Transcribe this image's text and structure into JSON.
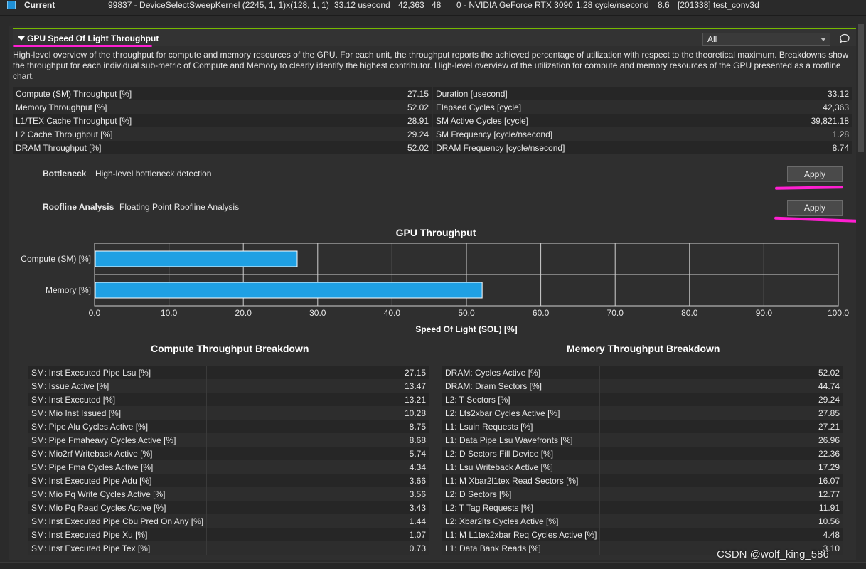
{
  "result": {
    "label": "Current",
    "id_kernel": "99837 - DeviceSelectSweepKernel (2245, 1, 1)x(128, 1, 1)",
    "duration": "33.12 usecond",
    "cycles": "42,363",
    "regs": "48",
    "device": "0 - NVIDIA GeForce RTX 3090",
    "frequency": "1.28 cycle/nsecond",
    "cc": "8.6",
    "process": "[201338] test_conv3d",
    "accent_color": "#1e90d6"
  },
  "section": {
    "title": "GPU Speed Of Light Throughput",
    "filter": "All",
    "description": "High-level overview of the throughput for compute and memory resources of the GPU. For each unit, the throughput reports the achieved percentage of utilization with respect to the theoretical maximum. Breakdowns show the throughput for each individual sub-metric of Compute and Memory to clearly identify the highest contributor. High-level overview of the utilization for compute and memory resources of the GPU presented as a roofline chart.",
    "header_accent": "#76b900"
  },
  "metrics_left": [
    {
      "name": "Compute (SM) Throughput [%]",
      "value": "27.15"
    },
    {
      "name": "Memory Throughput [%]",
      "value": "52.02"
    },
    {
      "name": "L1/TEX Cache Throughput [%]",
      "value": "28.91"
    },
    {
      "name": "L2 Cache Throughput [%]",
      "value": "29.24"
    },
    {
      "name": "DRAM Throughput [%]",
      "value": "52.02"
    }
  ],
  "metrics_right": [
    {
      "name": "Duration [usecond]",
      "value": "33.12"
    },
    {
      "name": "Elapsed Cycles [cycle]",
      "value": "42,363"
    },
    {
      "name": "SM Active Cycles [cycle]",
      "value": "39,821.18"
    },
    {
      "name": "SM Frequency [cycle/nsecond]",
      "value": "1.28"
    },
    {
      "name": "DRAM Frequency [cycle/nsecond]",
      "value": "8.74"
    }
  ],
  "rules": [
    {
      "name": "Bottleneck",
      "desc": "High-level bottleneck detection",
      "button": "Apply"
    },
    {
      "name": "Roofline Analysis",
      "desc": "Floating Point Roofline Analysis",
      "button": "Apply"
    }
  ],
  "chart_data": {
    "type": "bar",
    "orientation": "horizontal",
    "title": "GPU Throughput",
    "xlabel": "Speed Of Light (SOL) [%]",
    "ylabel": "",
    "categories": [
      "Compute (SM) [%]",
      "Memory [%]"
    ],
    "values": [
      27.15,
      52.02
    ],
    "xlim": [
      0,
      100
    ],
    "xticks": [
      "0.0",
      "10.0",
      "20.0",
      "30.0",
      "40.0",
      "50.0",
      "60.0",
      "70.0",
      "80.0",
      "90.0",
      "100.0"
    ],
    "grid": true,
    "bar_color": "#1fa0e3"
  },
  "compute_breakdown": {
    "title": "Compute Throughput Breakdown",
    "rows": [
      {
        "name": "SM: Inst Executed Pipe Lsu [%]",
        "value": "27.15"
      },
      {
        "name": "SM: Issue Active [%]",
        "value": "13.47"
      },
      {
        "name": "SM: Inst Executed [%]",
        "value": "13.21"
      },
      {
        "name": "SM: Mio Inst Issued [%]",
        "value": "10.28"
      },
      {
        "name": "SM: Pipe Alu Cycles Active [%]",
        "value": "8.75"
      },
      {
        "name": "SM: Pipe Fmaheavy Cycles Active [%]",
        "value": "8.68"
      },
      {
        "name": "SM: Mio2rf Writeback Active [%]",
        "value": "5.74"
      },
      {
        "name": "SM: Pipe Fma Cycles Active [%]",
        "value": "4.34"
      },
      {
        "name": "SM: Inst Executed Pipe Adu [%]",
        "value": "3.66"
      },
      {
        "name": "SM: Mio Pq Write Cycles Active [%]",
        "value": "3.56"
      },
      {
        "name": "SM: Mio Pq Read Cycles Active [%]",
        "value": "3.43"
      },
      {
        "name": "SM: Inst Executed Pipe Cbu Pred On Any [%]",
        "value": "1.44"
      },
      {
        "name": "SM: Inst Executed Pipe Xu [%]",
        "value": "1.07"
      },
      {
        "name": "SM: Inst Executed Pipe Tex [%]",
        "value": "0.73"
      }
    ]
  },
  "memory_breakdown": {
    "title": "Memory Throughput Breakdown",
    "rows": [
      {
        "name": "DRAM: Cycles Active [%]",
        "value": "52.02"
      },
      {
        "name": "DRAM: Dram Sectors [%]",
        "value": "44.74"
      },
      {
        "name": "L2: T Sectors [%]",
        "value": "29.24"
      },
      {
        "name": "L2: Lts2xbar Cycles Active [%]",
        "value": "27.85"
      },
      {
        "name": "L1: Lsuin Requests [%]",
        "value": "27.21"
      },
      {
        "name": "L1: Data Pipe Lsu Wavefronts [%]",
        "value": "26.96"
      },
      {
        "name": "L2: D Sectors Fill Device [%]",
        "value": "22.36"
      },
      {
        "name": "L1: Lsu Writeback Active [%]",
        "value": "17.29"
      },
      {
        "name": "L1: M Xbar2l1tex Read Sectors [%]",
        "value": "16.07"
      },
      {
        "name": "L2: D Sectors [%]",
        "value": "12.77"
      },
      {
        "name": "L2: T Tag Requests [%]",
        "value": "11.91"
      },
      {
        "name": "L2: Xbar2lts Cycles Active [%]",
        "value": "10.56"
      },
      {
        "name": "L1: M L1tex2xbar Req Cycles Active [%]",
        "value": "4.48"
      },
      {
        "name": "L1: Data Bank Reads [%]",
        "value": "3.10"
      }
    ]
  },
  "watermark": "CSDN @wolf_king_586",
  "highlight_color": "#ff1fd1"
}
